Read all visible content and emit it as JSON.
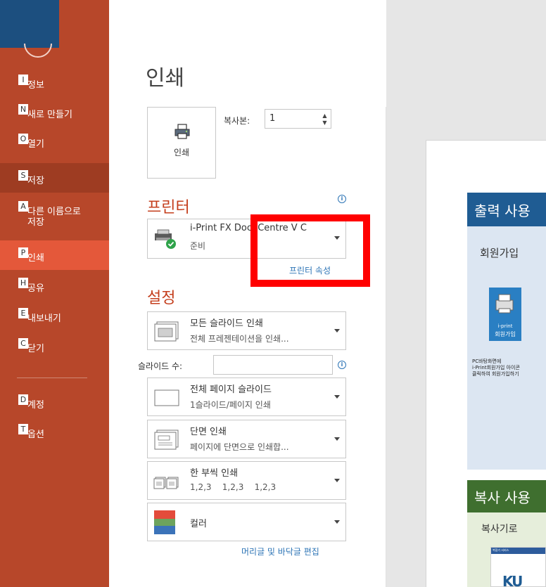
{
  "sidebar": {
    "items": [
      {
        "key": "I",
        "label": "정보"
      },
      {
        "key": "N",
        "label": "새로 만들기"
      },
      {
        "key": "O",
        "label": "열기"
      },
      {
        "key": "S",
        "label": "저장"
      },
      {
        "key": "A",
        "label": "다른 이름으로",
        "label2": "저장"
      },
      {
        "key": "P",
        "label": "인쇄"
      },
      {
        "key": "H",
        "label": "공유"
      },
      {
        "key": "E",
        "label": "내보내기"
      },
      {
        "key": "C",
        "label": "닫기"
      },
      {
        "key": "D",
        "label": "계정"
      },
      {
        "key": "T",
        "label": "옵션"
      }
    ]
  },
  "main": {
    "title": "인쇄",
    "print_button_label": "인쇄",
    "copies": {
      "label": "복사본:",
      "value": "1"
    },
    "printer": {
      "section_title": "프린터",
      "name": "i-Print FX DocuCentre V C",
      "status": "준비",
      "properties_link": "프린터 속성"
    },
    "settings": {
      "section_title": "설정",
      "range": {
        "main": "모든 슬라이드 인쇄",
        "sub": "전체 프레젠테이션을 인쇄..."
      },
      "slides_label": "슬라이드 수:",
      "slides_value": "",
      "layout": {
        "main": "전체 페이지 슬라이드",
        "sub": "1슬라이드/페이지 인쇄"
      },
      "sides": {
        "main": "단면 인쇄",
        "sub": "페이지에 단면으로 인쇄합..."
      },
      "collate": {
        "main": "한 부씩 인쇄",
        "sub": "1,2,3    1,2,3    1,2,3"
      },
      "color": {
        "main": "컬러"
      },
      "header_footer_link": "머리글 및 바닥글 편집"
    }
  },
  "preview": {
    "blue_header": "출력 사용",
    "blue_sub": "회원가입",
    "app_icon_line1": "i-print",
    "app_icon_line2": "회원가입",
    "note_line1": "PC바탕화면에",
    "note_line2": "i-Print회원가입 아이콘",
    "note_line3": "클릭하여 회원가입하기",
    "green_header": "복사 사용",
    "green_sub": "복사기로",
    "thumb_caption": "복합기 서비스",
    "thumb_logo": "KU"
  },
  "colors": {
    "sidebar": "#b7472a",
    "sidebar_active": "#e4583a",
    "accent_title": "#c43e1c",
    "link": "#2e75b6",
    "annotation_box": "#ff0000"
  }
}
